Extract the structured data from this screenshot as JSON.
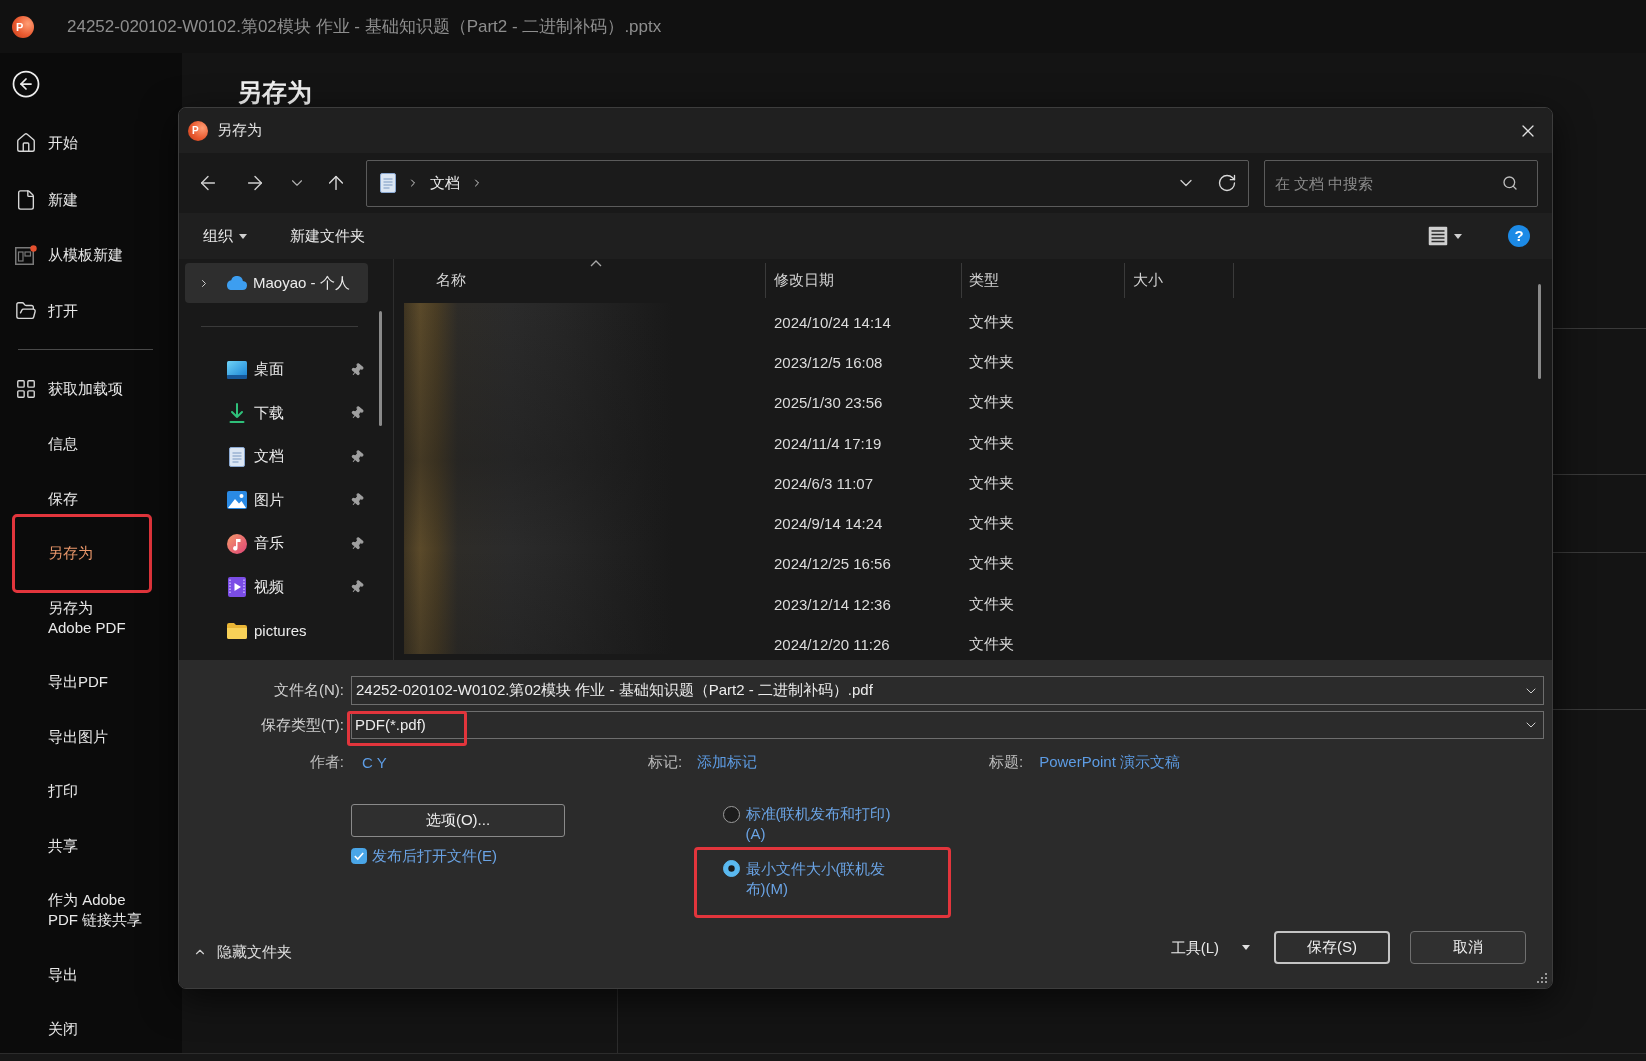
{
  "window": {
    "logo": "P",
    "title": "24252-020102-W0102.第02模块 作业 - 基础知识题（Part2 - 二进制补码）.pptx"
  },
  "sidebar": {
    "primary": [
      {
        "label": "开始",
        "selected": false,
        "highlighted": false
      },
      {
        "label": "新建",
        "selected": false,
        "highlighted": false
      },
      {
        "label": "从模板新建",
        "selected": false,
        "highlighted": false
      },
      {
        "label": "打开",
        "selected": false,
        "highlighted": false
      }
    ],
    "secondary": [
      {
        "label": "获取加载项",
        "selected": false,
        "highlighted": false
      },
      {
        "label": "信息",
        "selected": false,
        "highlighted": false
      },
      {
        "label": "保存",
        "selected": false,
        "highlighted": false
      },
      {
        "label": "另存为",
        "selected": true,
        "highlighted": true
      },
      {
        "label": "另存为\nAdobe PDF",
        "selected": false,
        "highlighted": false
      },
      {
        "label": "导出PDF",
        "selected": false,
        "highlighted": false
      },
      {
        "label": "导出图片",
        "selected": false,
        "highlighted": false
      },
      {
        "label": "打印",
        "selected": false,
        "highlighted": false
      },
      {
        "label": "共享",
        "selected": false,
        "highlighted": false
      },
      {
        "label": "作为 Adobe\nPDF 链接共享",
        "selected": false,
        "highlighted": false
      },
      {
        "label": "导出",
        "selected": false,
        "highlighted": false
      },
      {
        "label": "关闭",
        "selected": false,
        "highlighted": false
      }
    ]
  },
  "page": {
    "heading": "另存为"
  },
  "dialog": {
    "logo": "P",
    "title": "另存为",
    "address_bar": {
      "path": [
        "文档"
      ]
    },
    "search": {
      "placeholder": "在 文档 中搜索"
    },
    "toolbar": {
      "organize": "组织",
      "new_folder": "新建文件夹",
      "help": "?"
    },
    "nav_pane": {
      "root": {
        "label": "Maoyao - 个人",
        "selected": true,
        "expanded": false
      },
      "quick_access": [
        {
          "label": "桌面",
          "pinned": true,
          "selected": false
        },
        {
          "label": "下载",
          "pinned": true,
          "selected": false
        },
        {
          "label": "文档",
          "pinned": true,
          "selected": false
        },
        {
          "label": "图片",
          "pinned": true,
          "selected": false
        },
        {
          "label": "音乐",
          "pinned": true,
          "selected": false
        },
        {
          "label": "视频",
          "pinned": true,
          "selected": false
        },
        {
          "label": "pictures",
          "pinned": false,
          "selected": false
        }
      ]
    },
    "file_list": {
      "columns": [
        {
          "label": "名称",
          "sorted": true
        },
        {
          "label": "修改日期",
          "sorted": false
        },
        {
          "label": "类型",
          "sorted": false
        },
        {
          "label": "大小",
          "sorted": false
        }
      ],
      "rows": [
        {
          "modified": "2024/10/24 14:14",
          "type": "文件夹"
        },
        {
          "modified": "2023/12/5 16:08",
          "type": "文件夹"
        },
        {
          "modified": "2025/1/30 23:56",
          "type": "文件夹"
        },
        {
          "modified": "2024/11/4 17:19",
          "type": "文件夹"
        },
        {
          "modified": "2024/6/3 11:07",
          "type": "文件夹"
        },
        {
          "modified": "2024/9/14 14:24",
          "type": "文件夹"
        },
        {
          "modified": "2024/12/25 16:56",
          "type": "文件夹"
        },
        {
          "modified": "2023/12/14 12:36",
          "type": "文件夹"
        },
        {
          "modified": "2024/12/20 11:26",
          "type": "文件夹"
        }
      ]
    },
    "form": {
      "file_name": {
        "label": "文件名(N):",
        "value": "24252-020102-W0102.第02模块 作业 - 基础知识题（Part2 - 二进制补码）.pdf"
      },
      "save_type": {
        "label": "保存类型(T):",
        "value": "PDF(*.pdf)",
        "highlighted": true
      },
      "author": {
        "label": "作者:",
        "value": "C Y"
      },
      "tags": {
        "label": "标记:",
        "value": "添加标记"
      },
      "doc_title": {
        "label": "标题:",
        "value": "PowerPoint 演示文稿"
      },
      "options_button": "选项(O)...",
      "open_after_publish": {
        "label": "发布后打开文件(E)",
        "checked": true
      },
      "optimize": [
        {
          "label": "标准(联机发布和打印)(A)",
          "selected": false,
          "highlighted": false
        },
        {
          "label": "最小文件大小(联机发布)(M)",
          "selected": true,
          "highlighted": true
        }
      ],
      "hide_folders": "隐藏文件夹",
      "tools": "工具(L)",
      "buttons": [
        {
          "label": "保存(S)",
          "default": true
        },
        {
          "label": "取消",
          "default": false
        }
      ]
    }
  }
}
